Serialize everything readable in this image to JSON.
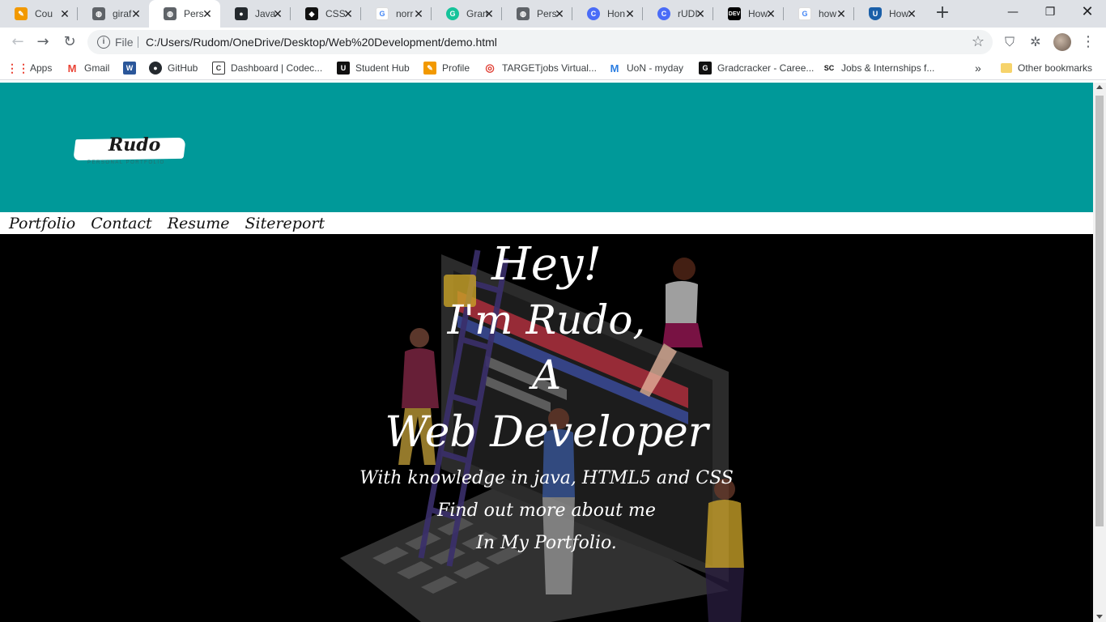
{
  "browser": {
    "tabs": [
      {
        "title": "Cou",
        "icon": "pencil-icon",
        "color": "#f29900"
      },
      {
        "title": "giraf",
        "icon": "globe-icon",
        "color": "#5f6368"
      },
      {
        "title": "Pers",
        "icon": "globe-icon",
        "color": "#5f6368",
        "active": true
      },
      {
        "title": "Java",
        "icon": "github-icon",
        "color": "#24292e"
      },
      {
        "title": "CSS",
        "icon": "codepen-icon",
        "color": "#111111"
      },
      {
        "title": "norr",
        "icon": "google-icon",
        "color": "#4285f4"
      },
      {
        "title": "Gran",
        "icon": "grammarly-icon",
        "color": "#15c39a"
      },
      {
        "title": "Pers",
        "icon": "globe-icon",
        "color": "#5f6368"
      },
      {
        "title": "Hon",
        "icon": "c-icon",
        "color": "#4a6cf7"
      },
      {
        "title": "rUDI",
        "icon": "c-icon",
        "color": "#4a6cf7"
      },
      {
        "title": "How",
        "icon": "dev-icon",
        "color": "#000000"
      },
      {
        "title": "how",
        "icon": "google-icon",
        "color": "#4285f4"
      },
      {
        "title": "How",
        "icon": "shield-icon",
        "color": "#1a5fa8"
      }
    ],
    "address": {
      "scheme": "File",
      "url": "C:/Users/Rudom/OneDrive/Desktop/Web%20Development/demo.html"
    },
    "bookmarks": [
      {
        "label": "Apps",
        "icon": "apps-grid-icon"
      },
      {
        "label": "Gmail",
        "icon": "gmail-icon"
      },
      {
        "label": "",
        "icon": "word-icon"
      },
      {
        "label": "GitHub",
        "icon": "github-icon"
      },
      {
        "label": "Dashboard | Codec...",
        "icon": "codecademy-icon"
      },
      {
        "label": "Student Hub",
        "icon": "studenthub-icon"
      },
      {
        "label": "Profile",
        "icon": "pencil-icon"
      },
      {
        "label": "TARGETjobs Virtual...",
        "icon": "targetjobs-icon"
      },
      {
        "label": "UoN - myday",
        "icon": "uon-icon"
      },
      {
        "label": "Gradcracker - Caree...",
        "icon": "gradcracker-icon"
      },
      {
        "label": "Jobs & Internships f...",
        "icon": "sc-icon"
      }
    ],
    "overflow_label": "»",
    "other_bookmarks": "Other bookmarks"
  },
  "site": {
    "logo": {
      "name": "Rudo",
      "tagline": "PERSONAL PORTFOLIO"
    },
    "nav": [
      "Portfolio",
      "Contact",
      "Resume",
      "Sitereport"
    ],
    "hero": {
      "line1": "Hey!",
      "line2": "I'm Rudo,",
      "line3": "A",
      "line4": "Web Developer",
      "sub1": "With knowledge in java, HTML5 and CSS",
      "sub2": "Find out more about me",
      "sub3": "In My Portfolio."
    },
    "colors": {
      "header_bg": "#009999",
      "nav_bg": "#ffffff",
      "hero_bg": "#000000"
    }
  }
}
